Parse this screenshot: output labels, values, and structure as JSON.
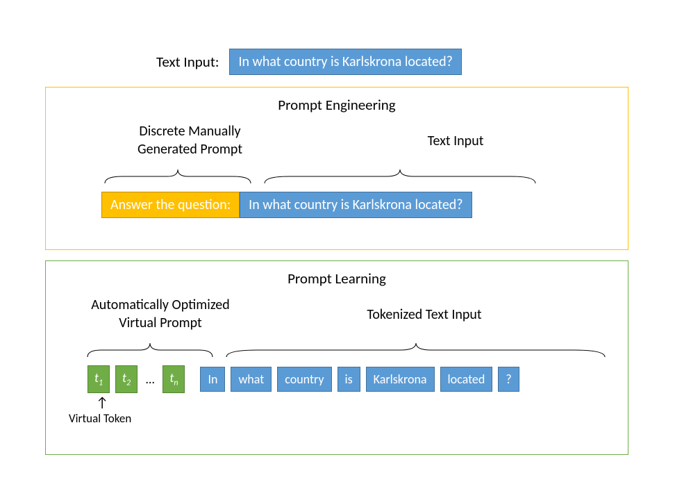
{
  "header": {
    "label": "Text Input:",
    "question": "In what country is Karlskrona located?"
  },
  "panel1": {
    "title": "Prompt Engineering",
    "left_label_line1": "Discrete Manually",
    "left_label_line2": "Generated Prompt",
    "right_label": "Text Input",
    "yellow_text": "Answer the question:",
    "blue_text": "In what country is Karlskrona located?"
  },
  "panel2": {
    "title": "Prompt Learning",
    "left_label_line1": "Automatically Optimized",
    "left_label_line2": "Virtual Prompt",
    "right_label": "Tokenized Text Input",
    "virtual_tokens": [
      "t",
      "t",
      "t"
    ],
    "virtual_subs": [
      "1",
      "2",
      "n"
    ],
    "ellipsis": "…",
    "tokens": [
      "In",
      "what",
      "country",
      "is",
      "Karlskrona",
      "located",
      "?"
    ],
    "arrow_label": "Virtual Token"
  }
}
